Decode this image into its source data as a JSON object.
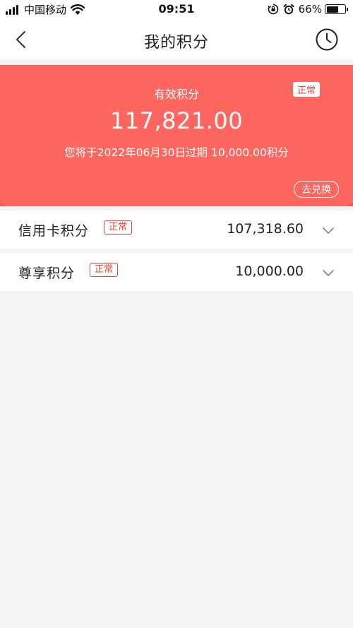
{
  "status_bar": {
    "carrier": "中国移动",
    "time": "09:51",
    "battery_percent": "66%",
    "battery_level": 0.66
  },
  "nav": {
    "title": "我的积分"
  },
  "banner": {
    "label": "有效积分",
    "amount": "117,821.00",
    "expiry_note": "您将于2022年06月30日过期 10,000.00积分",
    "status_badge": "正常",
    "exchange_label": "去兑换"
  },
  "points_list": [
    {
      "name": "信用卡积分",
      "status": "正常",
      "value": "107,318.60"
    },
    {
      "name": "尊享积分",
      "status": "正常",
      "value": "10,000.00"
    }
  ],
  "colors": {
    "accent": "#e8453c",
    "banner": "#f1584f"
  }
}
